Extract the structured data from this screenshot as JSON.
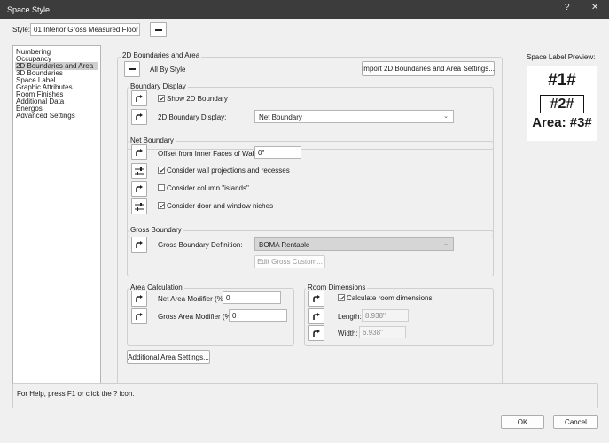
{
  "window": {
    "title": "Space Style",
    "help_glyph": "?",
    "close_glyph": "✕"
  },
  "style": {
    "label": "Style:",
    "value": "01 Interior Gross Measured Floor"
  },
  "nav": {
    "items": [
      {
        "label": "Numbering"
      },
      {
        "label": "Occupancy"
      },
      {
        "label": "2D Boundaries and Area",
        "selected": true
      },
      {
        "label": "3D Boundaries"
      },
      {
        "label": "Space Label"
      },
      {
        "label": "Graphic Attributes"
      },
      {
        "label": "Room Finishes"
      },
      {
        "label": "Additional Data"
      },
      {
        "label": "Energos"
      },
      {
        "label": "Advanced Settings"
      }
    ]
  },
  "panel": {
    "title": "2D Boundaries and Area",
    "all_by_style": "All By Style",
    "import_button": "Import 2D Boundaries and Area Settings..."
  },
  "boundary_display": {
    "title": "Boundary Display",
    "show_2d_boundary": {
      "label": "Show 2D Boundary",
      "checked": true
    },
    "display_label": "2D Boundary Display:",
    "display_value": "Net Boundary"
  },
  "net_boundary": {
    "title": "Net Boundary",
    "offset_label": "Offset from Inner Faces of Walls:",
    "offset_value": "0\"",
    "wall_projections": {
      "label": "Consider wall projections and recesses",
      "checked": true
    },
    "column_islands": {
      "label": "Consider column \"islands\"",
      "checked": false
    },
    "door_window_niches": {
      "label": "Consider door and window niches",
      "checked": true
    }
  },
  "gross_boundary": {
    "title": "Gross Boundary",
    "definition_label": "Gross Boundary Definition:",
    "definition_value": "BOMA Rentable",
    "edit_button": "Edit Gross Custom..."
  },
  "area_calculation": {
    "title": "Area Calculation",
    "net_label": "Net Area Modifier (%):",
    "net_value": "0",
    "gross_label": "Gross Area Modifier (%):",
    "gross_value": "0"
  },
  "room_dimensions": {
    "title": "Room Dimensions",
    "calculate": {
      "label": "Calculate room dimensions",
      "checked": true
    },
    "length_label": "Length:",
    "length_value": "8.938\"",
    "width_label": "Width:",
    "width_value": "6.938\""
  },
  "additional_area_button": "Additional Area Settings...",
  "preview": {
    "title": "Space Label Preview:",
    "line1": "#1#",
    "line2": "#2#",
    "line3": "Area: #3#"
  },
  "help_text": "For Help, press F1 or click the ? icon.",
  "footer": {
    "ok": "OK",
    "cancel": "Cancel"
  },
  "icons": {
    "titlebar_help": "help-icon",
    "titlebar_close": "close-icon",
    "style_toggle": "minus-icon",
    "override": "curved-arrow-icon",
    "adjust": "sliders-icon"
  }
}
